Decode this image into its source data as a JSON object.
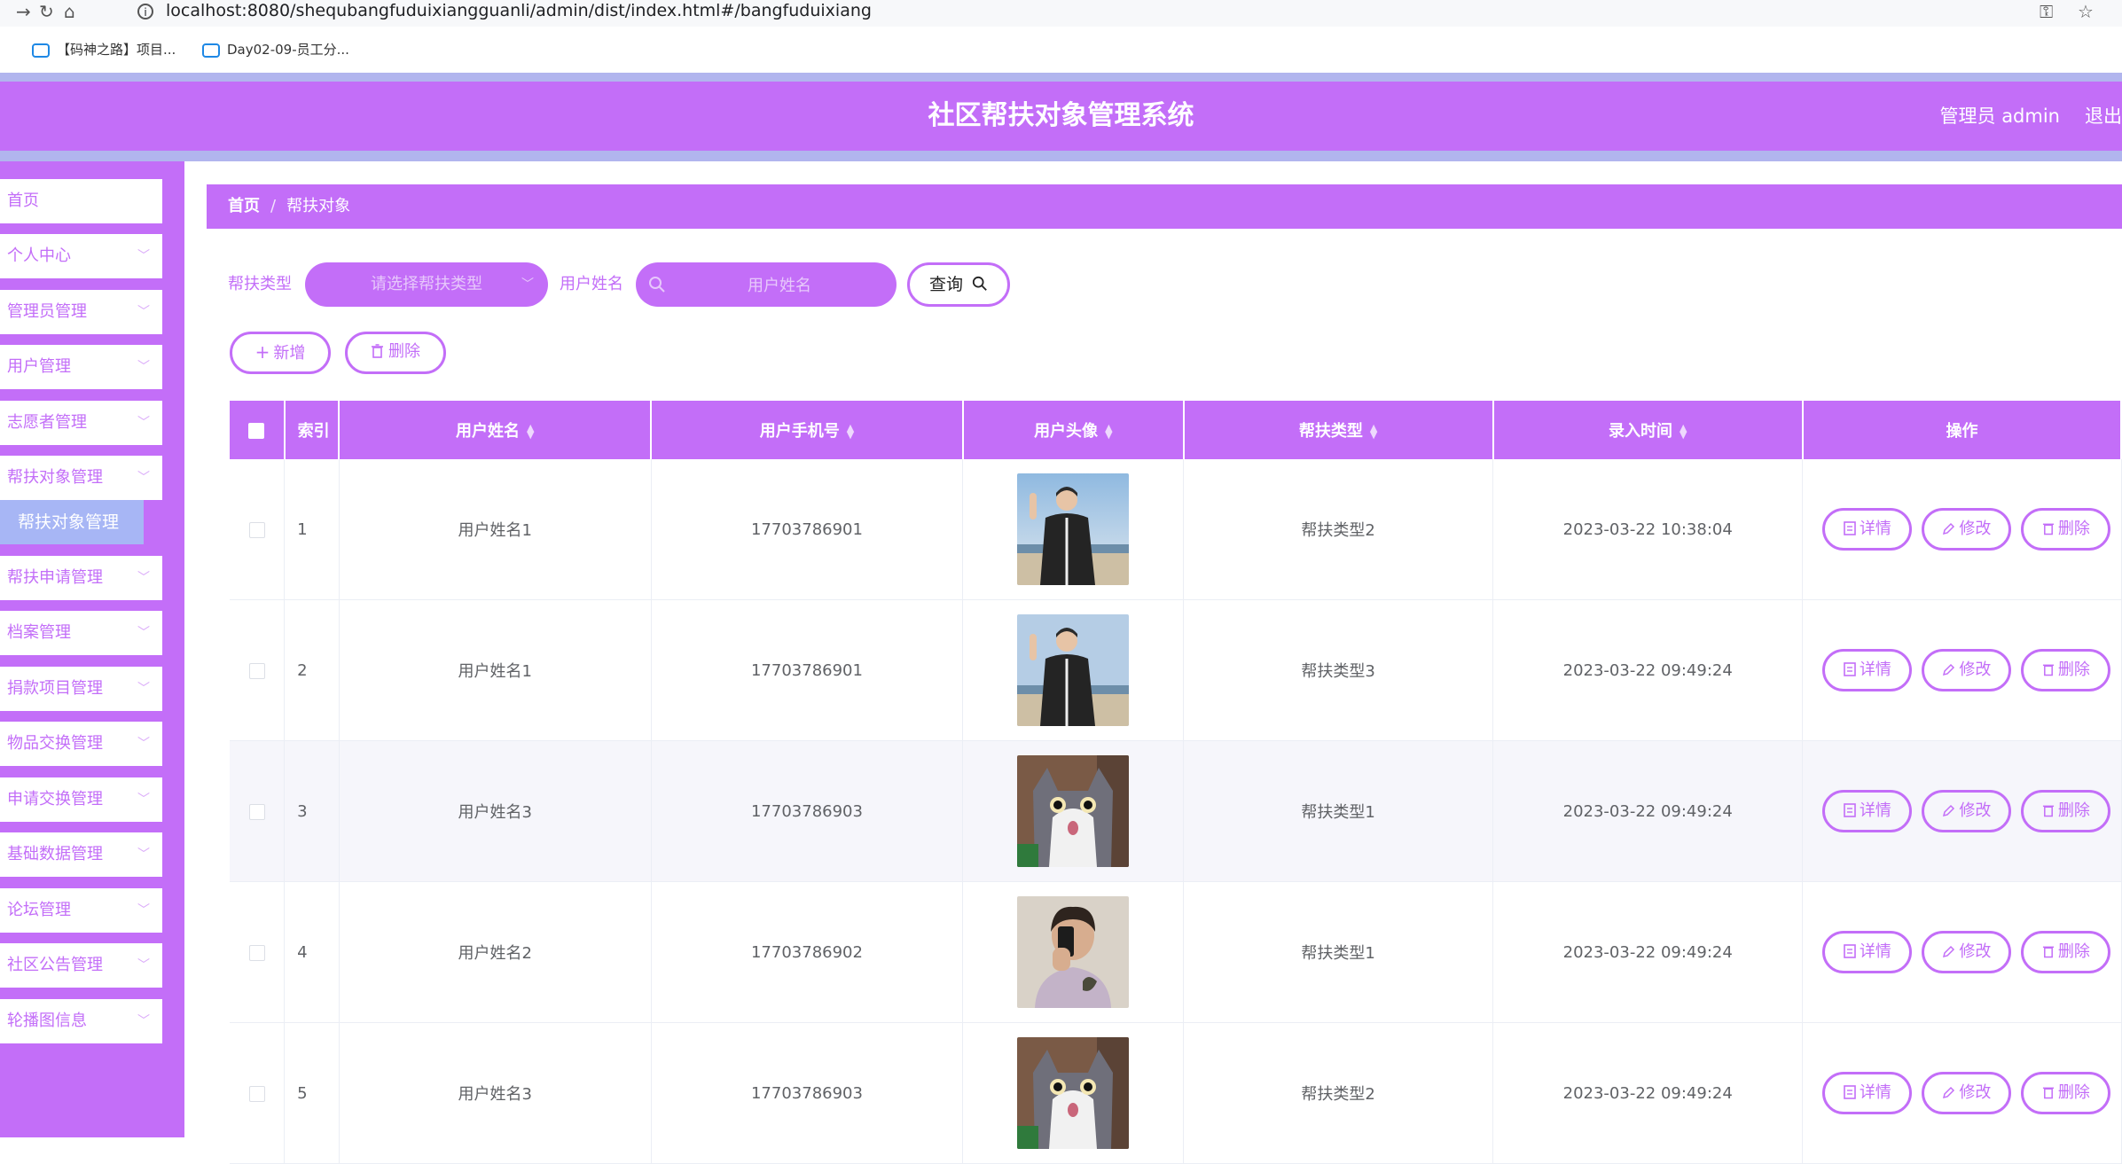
{
  "browser": {
    "url": "localhost:8080/shequbangfuduixiangguanli/admin/dist/index.html#/bangfuduixiang",
    "bookmarks": [
      {
        "label": "【码神之路】项目..."
      },
      {
        "label": "Day02-09-员工分..."
      }
    ]
  },
  "header": {
    "title": "社区帮扶对象管理系统",
    "user_label": "管理员 admin",
    "logout_label": "退出"
  },
  "sidebar": {
    "items": [
      {
        "label": "首页"
      },
      {
        "label": "个人中心"
      },
      {
        "label": "管理员管理"
      },
      {
        "label": "用户管理"
      },
      {
        "label": "志愿者管理"
      },
      {
        "label": "帮扶对象管理"
      },
      {
        "label": "帮扶申请管理"
      },
      {
        "label": "档案管理"
      },
      {
        "label": "捐款项目管理"
      },
      {
        "label": "物品交换管理"
      },
      {
        "label": "申请交换管理"
      },
      {
        "label": "基础数据管理"
      },
      {
        "label": "论坛管理"
      },
      {
        "label": "社区公告管理"
      },
      {
        "label": "轮播图信息"
      }
    ],
    "active_sub": "帮扶对象管理"
  },
  "breadcrumb": {
    "home": "首页",
    "sep": "/",
    "current": "帮扶对象"
  },
  "filters": {
    "type_label": "帮扶类型",
    "type_placeholder": "请选择帮扶类型",
    "name_label": "用户姓名",
    "name_placeholder": "用户姓名",
    "search_label": "查询"
  },
  "actions": {
    "add_label": "新增",
    "delete_label": "删除"
  },
  "table": {
    "columns": {
      "index": "索引",
      "name": "用户姓名",
      "phone": "用户手机号",
      "avatar": "用户头像",
      "type": "帮扶类型",
      "time": "录入时间",
      "ops": "操作"
    },
    "op_labels": {
      "detail": "详情",
      "edit": "修改",
      "delete": "删除"
    },
    "rows": [
      {
        "index": "1",
        "name": "用户姓名1",
        "phone": "17703786901",
        "avatar": "man-peace-photo",
        "type": "帮扶类型2",
        "time": "2023-03-22 10:38:04"
      },
      {
        "index": "2",
        "name": "用户姓名1",
        "phone": "17703786901",
        "avatar": "man-peace-photo",
        "type": "帮扶类型3",
        "time": "2023-03-22 09:49:24"
      },
      {
        "index": "3",
        "name": "用户姓名3",
        "phone": "17703786903",
        "avatar": "cat-photo",
        "type": "帮扶类型1",
        "time": "2023-03-22 09:49:24"
      },
      {
        "index": "4",
        "name": "用户姓名2",
        "phone": "17703786902",
        "avatar": "man-selfie-photo",
        "type": "帮扶类型1",
        "time": "2023-03-22 09:49:24"
      },
      {
        "index": "5",
        "name": "用户姓名3",
        "phone": "17703786903",
        "avatar": "cat-photo",
        "type": "帮扶类型2",
        "time": "2023-03-22 09:49:24"
      }
    ]
  },
  "colors": {
    "accent": "#c36ef8",
    "strip": "#b1b5ee",
    "submenu": "#a7b6f5"
  }
}
